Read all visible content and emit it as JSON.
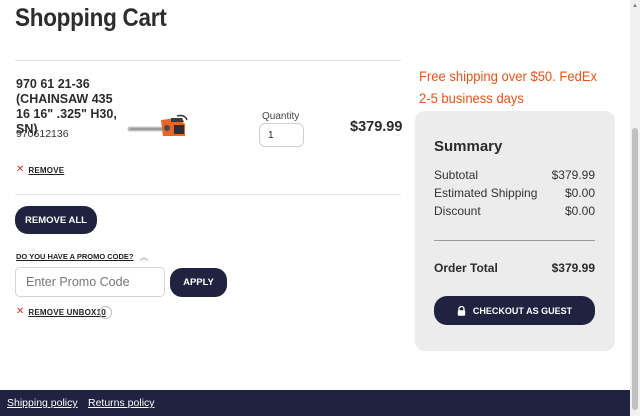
{
  "page": {
    "title": "Shopping Cart"
  },
  "cart_item": {
    "name": "970 61 21-36 (CHAINSAW 435 16 16\" .325\" H30, SN)",
    "sku": "970612136",
    "quantity_label": "Quantity",
    "quantity_value": "1",
    "price": "$379.99",
    "remove_label": "REMOVE",
    "image_icon": "chainsaw-product-image"
  },
  "actions": {
    "remove_all_label": "REMOVE ALL"
  },
  "promo": {
    "question": "DO YOU HAVE A PROMO CODE?",
    "placeholder": "Enter Promo Code",
    "apply_label": "APPLY",
    "applied_code_label": "REMOVE UNBOX10"
  },
  "shipping_promo": "Free shipping over $50. FedEx 2-5 business days",
  "summary": {
    "title": "Summary",
    "rows": [
      {
        "label": "Subtotal",
        "value": "$379.99"
      },
      {
        "label": "Estimated Shipping",
        "value": "$0.00"
      },
      {
        "label": "Discount",
        "value": "$0.00"
      }
    ],
    "total_label": "Order Total",
    "total_value": "$379.99",
    "checkout_label": "CHECKOUT AS GUEST"
  },
  "footer": {
    "links": [
      "Shipping policy",
      "Returns policy"
    ]
  },
  "colors": {
    "accent_dark": "#1f2340",
    "promo_orange": "#e2541b",
    "summary_bg": "#ececec",
    "remove_x": "#cc3333"
  }
}
